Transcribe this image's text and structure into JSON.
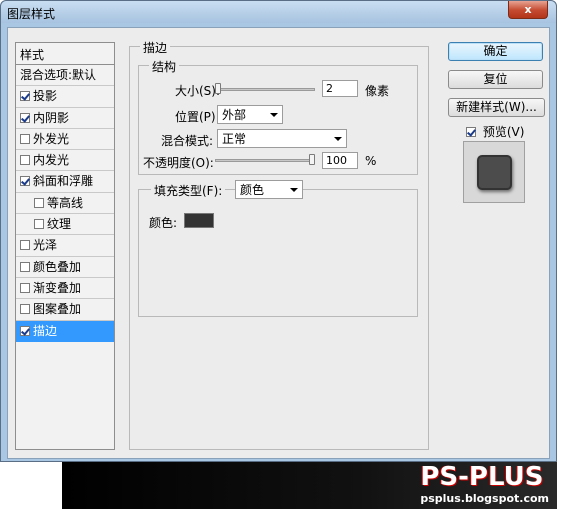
{
  "window": {
    "title": "图层样式",
    "close_label": "x"
  },
  "style_list": {
    "header": "样式",
    "items": [
      {
        "label": "混合选项:默认",
        "checkbox": false,
        "checked": false,
        "indent": false,
        "selected": false
      },
      {
        "label": "投影",
        "checkbox": true,
        "checked": true,
        "indent": false,
        "selected": false
      },
      {
        "label": "内阴影",
        "checkbox": true,
        "checked": true,
        "indent": false,
        "selected": false
      },
      {
        "label": "外发光",
        "checkbox": true,
        "checked": false,
        "indent": false,
        "selected": false
      },
      {
        "label": "内发光",
        "checkbox": true,
        "checked": false,
        "indent": false,
        "selected": false
      },
      {
        "label": "斜面和浮雕",
        "checkbox": true,
        "checked": true,
        "indent": false,
        "selected": false
      },
      {
        "label": "等高线",
        "checkbox": true,
        "checked": false,
        "indent": true,
        "selected": false
      },
      {
        "label": "纹理",
        "checkbox": true,
        "checked": false,
        "indent": true,
        "selected": false
      },
      {
        "label": "光泽",
        "checkbox": true,
        "checked": false,
        "indent": false,
        "selected": false
      },
      {
        "label": "颜色叠加",
        "checkbox": true,
        "checked": false,
        "indent": false,
        "selected": false
      },
      {
        "label": "渐变叠加",
        "checkbox": true,
        "checked": false,
        "indent": false,
        "selected": false
      },
      {
        "label": "图案叠加",
        "checkbox": true,
        "checked": false,
        "indent": false,
        "selected": false
      },
      {
        "label": "描边",
        "checkbox": true,
        "checked": true,
        "indent": false,
        "selected": true
      }
    ]
  },
  "stroke": {
    "legend": "描边",
    "structure": {
      "legend": "结构",
      "size_label": "大小(S):",
      "size_value": "2",
      "size_unit": "像素",
      "position_label": "位置(P):",
      "position_value": "外部",
      "blend_label": "混合模式:",
      "blend_value": "正常",
      "opacity_label": "不透明度(O):",
      "opacity_value": "100",
      "opacity_unit": "%",
      "opacity_level": 1.0,
      "size_level": 0.0
    },
    "fill": {
      "type_label": "填充类型(F):",
      "type_value": "颜色",
      "color_label": "颜色:",
      "color_hex": "#333333"
    }
  },
  "buttons": {
    "ok": "确定",
    "reset": "复位",
    "new_style": "新建样式(W)...",
    "preview_label": "预览(V)",
    "preview_checked": true
  },
  "watermark": {
    "main": "PS-PLUS",
    "sub": "psplus.blogspot.com"
  }
}
